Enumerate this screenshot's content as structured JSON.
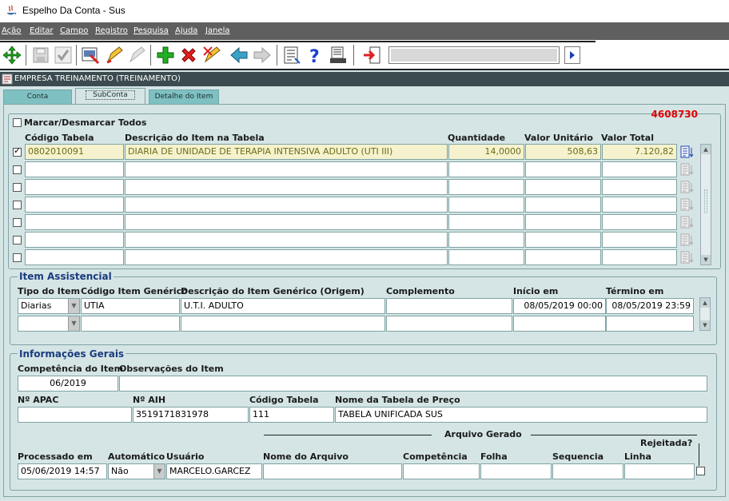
{
  "window": {
    "title": "Espelho Da Conta - Sus"
  },
  "menu": [
    "Ação",
    "Editar",
    "Campo",
    "Registro",
    "Pesquisa",
    "Ajuda",
    "Janela"
  ],
  "company": "EMPRESA TREINAMENTO (TREINAMENTO)",
  "tabs": [
    "Conta",
    "SubConta",
    "Detalhe do Item"
  ],
  "account_number": "4608730",
  "select_all_label": "Marcar/Desmarcar Todos",
  "items": {
    "headers": {
      "codigo": "Código Tabela",
      "descricao": "Descrição do Item na Tabela",
      "quantidade": "Quantidade",
      "valor_unitario": "Valor Unitário",
      "valor_total": "Valor Total"
    },
    "rows": [
      {
        "checked": true,
        "codigo": "0802010091",
        "descricao": "DIARIA DE UNIDADE DE TERAPIA INTENSIVA ADULTO (UTI III)",
        "quantidade": "14,0000",
        "valor_unitario": "508,63",
        "valor_total": "7.120,82"
      },
      {
        "checked": false,
        "codigo": "",
        "descricao": "",
        "quantidade": "",
        "valor_unitario": "",
        "valor_total": ""
      },
      {
        "checked": false,
        "codigo": "",
        "descricao": "",
        "quantidade": "",
        "valor_unitario": "",
        "valor_total": ""
      },
      {
        "checked": false,
        "codigo": "",
        "descricao": "",
        "quantidade": "",
        "valor_unitario": "",
        "valor_total": ""
      },
      {
        "checked": false,
        "codigo": "",
        "descricao": "",
        "quantidade": "",
        "valor_unitario": "",
        "valor_total": ""
      },
      {
        "checked": false,
        "codigo": "",
        "descricao": "",
        "quantidade": "",
        "valor_unitario": "",
        "valor_total": ""
      },
      {
        "checked": false,
        "codigo": "",
        "descricao": "",
        "quantidade": "",
        "valor_unitario": "",
        "valor_total": ""
      }
    ]
  },
  "assistencial": {
    "title": "Item Assistencial",
    "headers": {
      "tipo": "Tipo do Item",
      "codigo_generico": "Código Item Genérico",
      "descricao_generico": "Descrição do Item Genérico (Origem)",
      "complemento": "Complemento",
      "inicio": "Início em",
      "termino": "Término em"
    },
    "rows": [
      {
        "tipo": "Diarias",
        "codigo_generico": "UTIA",
        "descricao_generico": "U.T.I. ADULTO",
        "complemento": "",
        "inicio": "08/05/2019 00:00",
        "termino": "08/05/2019 23:59"
      },
      {
        "tipo": "",
        "codigo_generico": "",
        "descricao_generico": "",
        "complemento": "",
        "inicio": "",
        "termino": ""
      }
    ]
  },
  "gerais": {
    "title": "Informações Gerais",
    "competencia_label": "Competência do Item",
    "competencia": "06/2019",
    "observacoes_label": "Observações do Item",
    "observacoes": "",
    "apac_label": "Nº APAC",
    "apac": "",
    "aih_label": "Nº AIH",
    "aih": "3519171831978",
    "codigo_tabela_label": "Código Tabela",
    "codigo_tabela": "111",
    "nome_tabela_label": "Nome da Tabela de Preço",
    "nome_tabela": "TABELA UNIFICADA SUS",
    "arquivo_gerado_label": "Arquivo Gerado",
    "rejeitada_label": "Rejeitada?",
    "processado_label": "Processado em",
    "processado": "05/06/2019 14:57",
    "automatico_label": "Automático",
    "automatico": "Não",
    "usuario_label": "Usuário",
    "usuario": "MARCELO.GARCEZ",
    "nome_arquivo_label": "Nome do Arquivo",
    "nome_arquivo": "",
    "competencia_arq_label": "Competência",
    "competencia_arq": "",
    "folha_label": "Folha",
    "folha": "",
    "sequencia_label": "Sequencia",
    "sequencia": "",
    "linha_label": "Linha",
    "linha": ""
  },
  "colors": {
    "accent_red": "#e00000",
    "section_blue": "#1a3b7e",
    "tab": "#7fc1c3",
    "background": "#d5e5e5"
  }
}
